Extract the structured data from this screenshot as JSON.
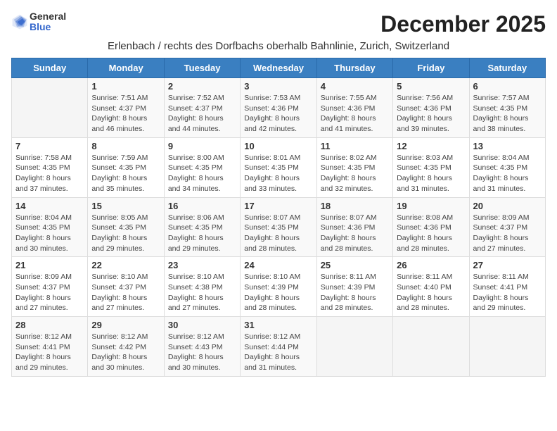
{
  "header": {
    "logo_general": "General",
    "logo_blue": "Blue",
    "month_title": "December 2025",
    "location": "Erlenbach / rechts des Dorfbachs oberhalb Bahnlinie, Zurich, Switzerland"
  },
  "days_of_week": [
    "Sunday",
    "Monday",
    "Tuesday",
    "Wednesday",
    "Thursday",
    "Friday",
    "Saturday"
  ],
  "weeks": [
    [
      {
        "day": "",
        "detail": ""
      },
      {
        "day": "1",
        "detail": "Sunrise: 7:51 AM\nSunset: 4:37 PM\nDaylight: 8 hours\nand 46 minutes."
      },
      {
        "day": "2",
        "detail": "Sunrise: 7:52 AM\nSunset: 4:37 PM\nDaylight: 8 hours\nand 44 minutes."
      },
      {
        "day": "3",
        "detail": "Sunrise: 7:53 AM\nSunset: 4:36 PM\nDaylight: 8 hours\nand 42 minutes."
      },
      {
        "day": "4",
        "detail": "Sunrise: 7:55 AM\nSunset: 4:36 PM\nDaylight: 8 hours\nand 41 minutes."
      },
      {
        "day": "5",
        "detail": "Sunrise: 7:56 AM\nSunset: 4:36 PM\nDaylight: 8 hours\nand 39 minutes."
      },
      {
        "day": "6",
        "detail": "Sunrise: 7:57 AM\nSunset: 4:35 PM\nDaylight: 8 hours\nand 38 minutes."
      }
    ],
    [
      {
        "day": "7",
        "detail": "Sunrise: 7:58 AM\nSunset: 4:35 PM\nDaylight: 8 hours\nand 37 minutes."
      },
      {
        "day": "8",
        "detail": "Sunrise: 7:59 AM\nSunset: 4:35 PM\nDaylight: 8 hours\nand 35 minutes."
      },
      {
        "day": "9",
        "detail": "Sunrise: 8:00 AM\nSunset: 4:35 PM\nDaylight: 8 hours\nand 34 minutes."
      },
      {
        "day": "10",
        "detail": "Sunrise: 8:01 AM\nSunset: 4:35 PM\nDaylight: 8 hours\nand 33 minutes."
      },
      {
        "day": "11",
        "detail": "Sunrise: 8:02 AM\nSunset: 4:35 PM\nDaylight: 8 hours\nand 32 minutes."
      },
      {
        "day": "12",
        "detail": "Sunrise: 8:03 AM\nSunset: 4:35 PM\nDaylight: 8 hours\nand 31 minutes."
      },
      {
        "day": "13",
        "detail": "Sunrise: 8:04 AM\nSunset: 4:35 PM\nDaylight: 8 hours\nand 31 minutes."
      }
    ],
    [
      {
        "day": "14",
        "detail": "Sunrise: 8:04 AM\nSunset: 4:35 PM\nDaylight: 8 hours\nand 30 minutes."
      },
      {
        "day": "15",
        "detail": "Sunrise: 8:05 AM\nSunset: 4:35 PM\nDaylight: 8 hours\nand 29 minutes."
      },
      {
        "day": "16",
        "detail": "Sunrise: 8:06 AM\nSunset: 4:35 PM\nDaylight: 8 hours\nand 29 minutes."
      },
      {
        "day": "17",
        "detail": "Sunrise: 8:07 AM\nSunset: 4:35 PM\nDaylight: 8 hours\nand 28 minutes."
      },
      {
        "day": "18",
        "detail": "Sunrise: 8:07 AM\nSunset: 4:36 PM\nDaylight: 8 hours\nand 28 minutes."
      },
      {
        "day": "19",
        "detail": "Sunrise: 8:08 AM\nSunset: 4:36 PM\nDaylight: 8 hours\nand 28 minutes."
      },
      {
        "day": "20",
        "detail": "Sunrise: 8:09 AM\nSunset: 4:37 PM\nDaylight: 8 hours\nand 27 minutes."
      }
    ],
    [
      {
        "day": "21",
        "detail": "Sunrise: 8:09 AM\nSunset: 4:37 PM\nDaylight: 8 hours\nand 27 minutes."
      },
      {
        "day": "22",
        "detail": "Sunrise: 8:10 AM\nSunset: 4:37 PM\nDaylight: 8 hours\nand 27 minutes."
      },
      {
        "day": "23",
        "detail": "Sunrise: 8:10 AM\nSunset: 4:38 PM\nDaylight: 8 hours\nand 27 minutes."
      },
      {
        "day": "24",
        "detail": "Sunrise: 8:10 AM\nSunset: 4:39 PM\nDaylight: 8 hours\nand 28 minutes."
      },
      {
        "day": "25",
        "detail": "Sunrise: 8:11 AM\nSunset: 4:39 PM\nDaylight: 8 hours\nand 28 minutes."
      },
      {
        "day": "26",
        "detail": "Sunrise: 8:11 AM\nSunset: 4:40 PM\nDaylight: 8 hours\nand 28 minutes."
      },
      {
        "day": "27",
        "detail": "Sunrise: 8:11 AM\nSunset: 4:41 PM\nDaylight: 8 hours\nand 29 minutes."
      }
    ],
    [
      {
        "day": "28",
        "detail": "Sunrise: 8:12 AM\nSunset: 4:41 PM\nDaylight: 8 hours\nand 29 minutes."
      },
      {
        "day": "29",
        "detail": "Sunrise: 8:12 AM\nSunset: 4:42 PM\nDaylight: 8 hours\nand 30 minutes."
      },
      {
        "day": "30",
        "detail": "Sunrise: 8:12 AM\nSunset: 4:43 PM\nDaylight: 8 hours\nand 30 minutes."
      },
      {
        "day": "31",
        "detail": "Sunrise: 8:12 AM\nSunset: 4:44 PM\nDaylight: 8 hours\nand 31 minutes."
      },
      {
        "day": "",
        "detail": ""
      },
      {
        "day": "",
        "detail": ""
      },
      {
        "day": "",
        "detail": ""
      }
    ]
  ],
  "colors": {
    "header_bg": "#3a7fc1",
    "header_text": "#ffffff",
    "row_odd": "#f9f9f9",
    "row_even": "#ffffff"
  }
}
